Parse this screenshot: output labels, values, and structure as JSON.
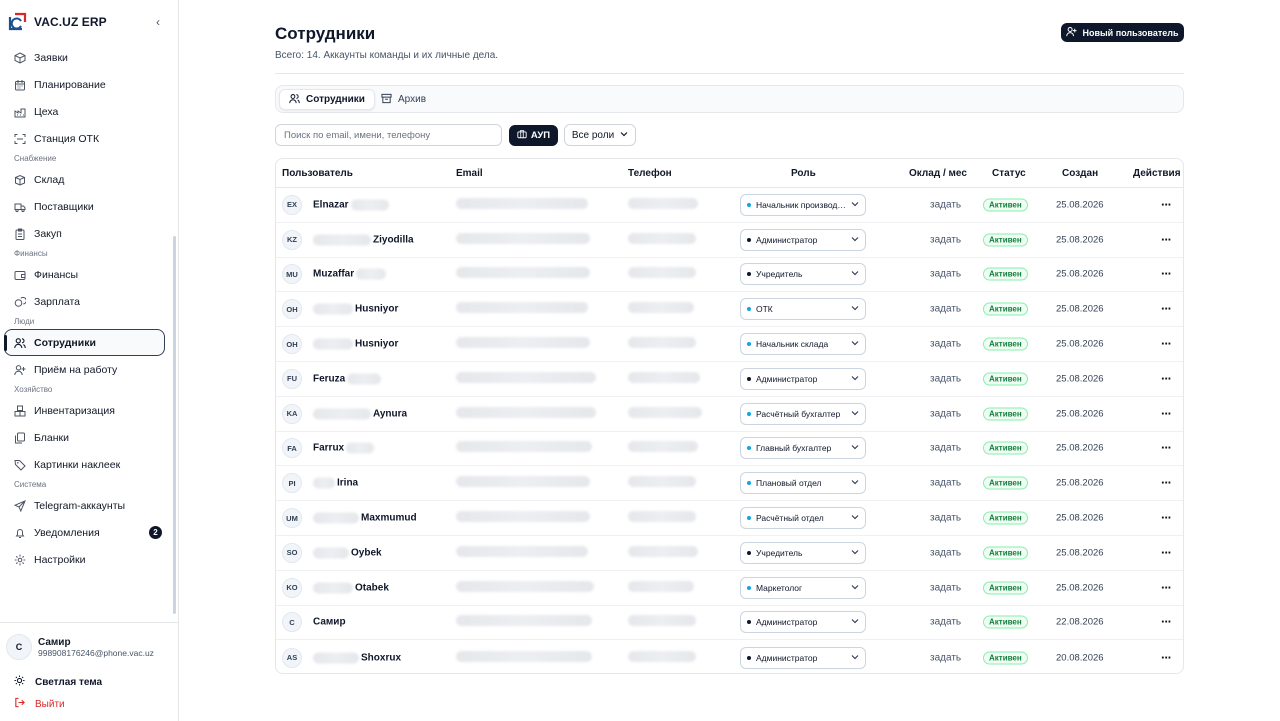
{
  "app": {
    "brand": "VAC.UZ ERP",
    "collapse_icon": "chevron-left-icon"
  },
  "sidebar": {
    "items": [
      {
        "type": "item",
        "label": "Заявки",
        "icon": "cube-icon"
      },
      {
        "type": "item",
        "label": "Планирование",
        "icon": "calendar-icon"
      },
      {
        "type": "item",
        "label": "Цеха",
        "icon": "factory-icon"
      },
      {
        "type": "item",
        "label": "Станция ОТК",
        "icon": "scan-icon"
      },
      {
        "type": "section",
        "label": "Снабжение"
      },
      {
        "type": "item",
        "label": "Склад",
        "icon": "box-icon"
      },
      {
        "type": "item",
        "label": "Поставщики",
        "icon": "truck-icon"
      },
      {
        "type": "item",
        "label": "Закуп",
        "icon": "clipboard-icon"
      },
      {
        "type": "section",
        "label": "Финансы"
      },
      {
        "type": "item",
        "label": "Финансы",
        "icon": "wallet-icon"
      },
      {
        "type": "item",
        "label": "Зарплата",
        "icon": "coins-icon"
      },
      {
        "type": "section",
        "label": "Люди"
      },
      {
        "type": "item",
        "label": "Сотрудники",
        "icon": "users-icon",
        "active": true
      },
      {
        "type": "item",
        "label": "Приём на работу",
        "icon": "user-plus-icon"
      },
      {
        "type": "section",
        "label": "Хозяйство"
      },
      {
        "type": "item",
        "label": "Инвентаризация",
        "icon": "boxes-icon"
      },
      {
        "type": "item",
        "label": "Бланки",
        "icon": "documents-icon"
      },
      {
        "type": "item",
        "label": "Картинки наклеек",
        "icon": "tag-icon"
      },
      {
        "type": "section",
        "label": "Система"
      },
      {
        "type": "item",
        "label": "Telegram-аккаунты",
        "icon": "send-icon"
      },
      {
        "type": "item",
        "label": "Уведомления",
        "icon": "bell-icon",
        "badge": "2"
      },
      {
        "type": "item",
        "label": "Настройки",
        "icon": "gear-icon"
      }
    ],
    "user": {
      "initial": "С",
      "name": "Самир",
      "login": "998908176246@phone.vac.uz"
    },
    "theme_label": "Светлая тема",
    "logout_label": "Выйти"
  },
  "header": {
    "title": "Сотрудники",
    "subtitle": "Всего: 14. Аккаунты команды и их личные дела.",
    "new_user_label": "Новый пользователь"
  },
  "tabs": {
    "employees": "Сотрудники",
    "archive": "Архив"
  },
  "filters": {
    "search_placeholder": "Поиск по email, имени, телефону",
    "search_value": "",
    "aup_label": "АУП",
    "roles_label": "Все роли"
  },
  "table": {
    "columns": {
      "user": "Пользователь",
      "email": "Email",
      "phone": "Телефон",
      "role": "Роль",
      "salary": "Оклад / мес",
      "status": "Статус",
      "created": "Создан",
      "actions": "Действия"
    },
    "rows": [
      {
        "initials": "EX",
        "name": "Elnazar",
        "role": "Начальник производства",
        "role_color": "#0ea5e9",
        "salary": "задать",
        "status": "Активен",
        "created": "25.08.2026"
      },
      {
        "initials": "KZ",
        "name": "Ziyodilla",
        "role": "Администратор",
        "role_color": "#0f172a",
        "salary": "задать",
        "status": "Активен",
        "created": "25.08.2026"
      },
      {
        "initials": "MU",
        "name": "Muzaffar",
        "role": "Учредитель",
        "role_color": "#0f172a",
        "salary": "задать",
        "status": "Активен",
        "created": "25.08.2026"
      },
      {
        "initials": "OH",
        "name": "Husniyor",
        "role": "ОТК",
        "role_color": "#0ea5e9",
        "salary": "задать",
        "status": "Активен",
        "created": "25.08.2026"
      },
      {
        "initials": "OH",
        "name": "Husniyor",
        "role": "Начальник склада",
        "role_color": "#0ea5e9",
        "salary": "задать",
        "status": "Активен",
        "created": "25.08.2026"
      },
      {
        "initials": "FU",
        "name": "Feruza",
        "role": "Администратор",
        "role_color": "#0f172a",
        "salary": "задать",
        "status": "Активен",
        "created": "25.08.2026"
      },
      {
        "initials": "KA",
        "name": "Aynura",
        "role": "Расчётный бухгалтер",
        "role_color": "#0ea5e9",
        "salary": "задать",
        "status": "Активен",
        "created": "25.08.2026"
      },
      {
        "initials": "FA",
        "name": "Farrux",
        "role": "Главный бухгалтер",
        "role_color": "#0ea5e9",
        "salary": "задать",
        "status": "Активен",
        "created": "25.08.2026"
      },
      {
        "initials": "PI",
        "name": "Irina",
        "role": "Плановый отдел",
        "role_color": "#0ea5e9",
        "salary": "задать",
        "status": "Активен",
        "created": "25.08.2026"
      },
      {
        "initials": "UM",
        "name": "Maxmumud",
        "role": "Расчётный отдел",
        "role_color": "#0ea5e9",
        "salary": "задать",
        "status": "Активен",
        "created": "25.08.2026"
      },
      {
        "initials": "SO",
        "name": "Oybek",
        "role": "Учредитель",
        "role_color": "#0f172a",
        "salary": "задать",
        "status": "Активен",
        "created": "25.08.2026"
      },
      {
        "initials": "KO",
        "name": "Otabek",
        "role": "Маркетолог",
        "role_color": "#0ea5e9",
        "salary": "задать",
        "status": "Активен",
        "created": "25.08.2026"
      },
      {
        "initials": "С",
        "name": "Самир",
        "role": "Администратор",
        "role_color": "#0f172a",
        "salary": "задать",
        "status": "Активен",
        "created": "22.08.2026"
      },
      {
        "initials": "AS",
        "name": "Shoxrux",
        "role": "Администратор",
        "role_color": "#0f172a",
        "salary": "задать",
        "status": "Активен",
        "created": "20.08.2026"
      }
    ]
  }
}
